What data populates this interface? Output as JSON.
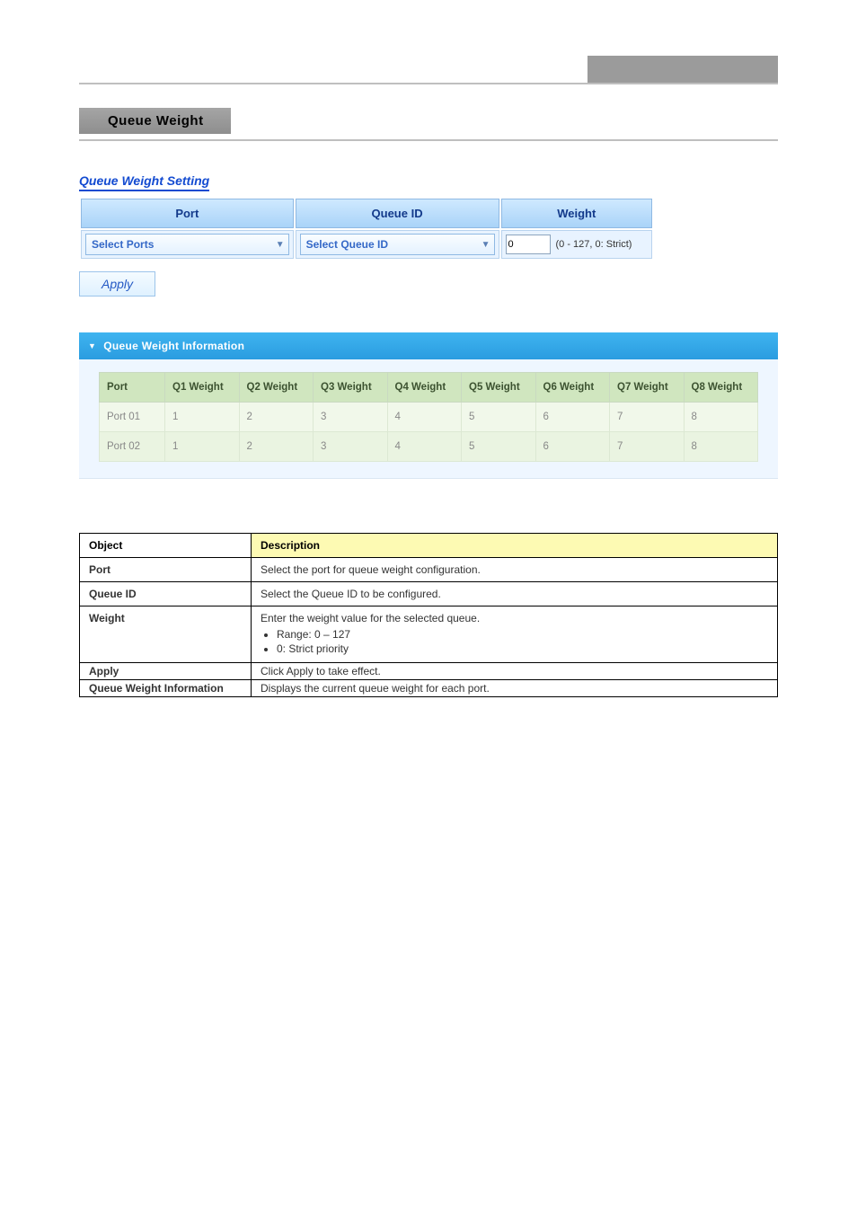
{
  "page": {
    "title": "Queue Weight"
  },
  "setting": {
    "section_title": "Queue Weight Setting",
    "cols": [
      "Port",
      "Queue ID",
      "Weight"
    ],
    "port_select": "Select Ports",
    "queue_select": "Select Queue ID",
    "weight_value": "0",
    "weight_hint": "(0 - 127, 0: Strict)",
    "apply_label": "Apply"
  },
  "info": {
    "section_title": "Queue Weight Information",
    "cols": [
      "Port",
      "Q1 Weight",
      "Q2 Weight",
      "Q3 Weight",
      "Q4 Weight",
      "Q5 Weight",
      "Q6 Weight",
      "Q7 Weight",
      "Q8 Weight"
    ],
    "rows": [
      {
        "port": "Port 01",
        "q": [
          "1",
          "2",
          "3",
          "4",
          "5",
          "6",
          "7",
          "8"
        ]
      },
      {
        "port": "Port 02",
        "q": [
          "1",
          "2",
          "3",
          "4",
          "5",
          "6",
          "7",
          "8"
        ]
      }
    ]
  },
  "desc": {
    "cols": [
      "Object",
      "Description"
    ],
    "rows": [
      {
        "obj": "Port",
        "text": "Select the port for queue weight configuration."
      },
      {
        "obj": "Queue ID",
        "text": "Select the Queue ID to be configured."
      },
      {
        "obj": "Weight",
        "text": "Enter the weight value for the selected queue.",
        "bullets": [
          "Range: 0 – 127",
          "0: Strict priority"
        ]
      },
      {
        "obj": "Apply",
        "text": "Click Apply to take effect."
      },
      {
        "obj": "Queue Weight Information",
        "text": "Displays the current queue weight for each port."
      }
    ]
  }
}
